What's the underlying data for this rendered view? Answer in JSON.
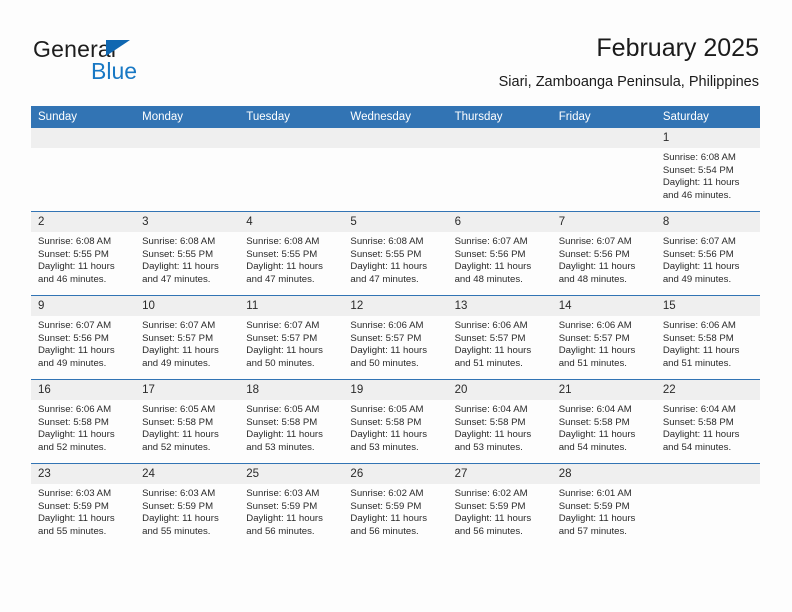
{
  "brand": {
    "word_one": "General",
    "word_two": "Blue",
    "icon": "triangle-logo-icon"
  },
  "header": {
    "month_title": "February 2025",
    "location": "Siari, Zamboanga Peninsula, Philippines"
  },
  "colors": {
    "header_blue": "#3274b4",
    "brand_blue": "#1878c4",
    "daynum_band": "#efefef",
    "page_background": "#fdfdfd",
    "text": "#2a2a2a"
  },
  "calendar": {
    "weekday_headers": [
      "Sunday",
      "Monday",
      "Tuesday",
      "Wednesday",
      "Thursday",
      "Friday",
      "Saturday"
    ],
    "labels": {
      "sunrise": "Sunrise:",
      "sunset": "Sunset:",
      "daylight": "Daylight:"
    },
    "weeks": [
      [
        {
          "day": "",
          "blank": true,
          "sunrise": "",
          "sunset": "",
          "daylight_line1": "",
          "daylight_line2": ""
        },
        {
          "day": "",
          "blank": true,
          "sunrise": "",
          "sunset": "",
          "daylight_line1": "",
          "daylight_line2": ""
        },
        {
          "day": "",
          "blank": true,
          "sunrise": "",
          "sunset": "",
          "daylight_line1": "",
          "daylight_line2": ""
        },
        {
          "day": "",
          "blank": true,
          "sunrise": "",
          "sunset": "",
          "daylight_line1": "",
          "daylight_line2": ""
        },
        {
          "day": "",
          "blank": true,
          "sunrise": "",
          "sunset": "",
          "daylight_line1": "",
          "daylight_line2": ""
        },
        {
          "day": "",
          "blank": true,
          "sunrise": "",
          "sunset": "",
          "daylight_line1": "",
          "daylight_line2": ""
        },
        {
          "day": "1",
          "blank": false,
          "sunrise": "Sunrise: 6:08 AM",
          "sunset": "Sunset: 5:54 PM",
          "daylight_line1": "Daylight: 11 hours",
          "daylight_line2": "and 46 minutes."
        }
      ],
      [
        {
          "day": "2",
          "blank": false,
          "sunrise": "Sunrise: 6:08 AM",
          "sunset": "Sunset: 5:55 PM",
          "daylight_line1": "Daylight: 11 hours",
          "daylight_line2": "and 46 minutes."
        },
        {
          "day": "3",
          "blank": false,
          "sunrise": "Sunrise: 6:08 AM",
          "sunset": "Sunset: 5:55 PM",
          "daylight_line1": "Daylight: 11 hours",
          "daylight_line2": "and 47 minutes."
        },
        {
          "day": "4",
          "blank": false,
          "sunrise": "Sunrise: 6:08 AM",
          "sunset": "Sunset: 5:55 PM",
          "daylight_line1": "Daylight: 11 hours",
          "daylight_line2": "and 47 minutes."
        },
        {
          "day": "5",
          "blank": false,
          "sunrise": "Sunrise: 6:08 AM",
          "sunset": "Sunset: 5:55 PM",
          "daylight_line1": "Daylight: 11 hours",
          "daylight_line2": "and 47 minutes."
        },
        {
          "day": "6",
          "blank": false,
          "sunrise": "Sunrise: 6:07 AM",
          "sunset": "Sunset: 5:56 PM",
          "daylight_line1": "Daylight: 11 hours",
          "daylight_line2": "and 48 minutes."
        },
        {
          "day": "7",
          "blank": false,
          "sunrise": "Sunrise: 6:07 AM",
          "sunset": "Sunset: 5:56 PM",
          "daylight_line1": "Daylight: 11 hours",
          "daylight_line2": "and 48 minutes."
        },
        {
          "day": "8",
          "blank": false,
          "sunrise": "Sunrise: 6:07 AM",
          "sunset": "Sunset: 5:56 PM",
          "daylight_line1": "Daylight: 11 hours",
          "daylight_line2": "and 49 minutes."
        }
      ],
      [
        {
          "day": "9",
          "blank": false,
          "sunrise": "Sunrise: 6:07 AM",
          "sunset": "Sunset: 5:56 PM",
          "daylight_line1": "Daylight: 11 hours",
          "daylight_line2": "and 49 minutes."
        },
        {
          "day": "10",
          "blank": false,
          "sunrise": "Sunrise: 6:07 AM",
          "sunset": "Sunset: 5:57 PM",
          "daylight_line1": "Daylight: 11 hours",
          "daylight_line2": "and 49 minutes."
        },
        {
          "day": "11",
          "blank": false,
          "sunrise": "Sunrise: 6:07 AM",
          "sunset": "Sunset: 5:57 PM",
          "daylight_line1": "Daylight: 11 hours",
          "daylight_line2": "and 50 minutes."
        },
        {
          "day": "12",
          "blank": false,
          "sunrise": "Sunrise: 6:06 AM",
          "sunset": "Sunset: 5:57 PM",
          "daylight_line1": "Daylight: 11 hours",
          "daylight_line2": "and 50 minutes."
        },
        {
          "day": "13",
          "blank": false,
          "sunrise": "Sunrise: 6:06 AM",
          "sunset": "Sunset: 5:57 PM",
          "daylight_line1": "Daylight: 11 hours",
          "daylight_line2": "and 51 minutes."
        },
        {
          "day": "14",
          "blank": false,
          "sunrise": "Sunrise: 6:06 AM",
          "sunset": "Sunset: 5:57 PM",
          "daylight_line1": "Daylight: 11 hours",
          "daylight_line2": "and 51 minutes."
        },
        {
          "day": "15",
          "blank": false,
          "sunrise": "Sunrise: 6:06 AM",
          "sunset": "Sunset: 5:58 PM",
          "daylight_line1": "Daylight: 11 hours",
          "daylight_line2": "and 51 minutes."
        }
      ],
      [
        {
          "day": "16",
          "blank": false,
          "sunrise": "Sunrise: 6:06 AM",
          "sunset": "Sunset: 5:58 PM",
          "daylight_line1": "Daylight: 11 hours",
          "daylight_line2": "and 52 minutes."
        },
        {
          "day": "17",
          "blank": false,
          "sunrise": "Sunrise: 6:05 AM",
          "sunset": "Sunset: 5:58 PM",
          "daylight_line1": "Daylight: 11 hours",
          "daylight_line2": "and 52 minutes."
        },
        {
          "day": "18",
          "blank": false,
          "sunrise": "Sunrise: 6:05 AM",
          "sunset": "Sunset: 5:58 PM",
          "daylight_line1": "Daylight: 11 hours",
          "daylight_line2": "and 53 minutes."
        },
        {
          "day": "19",
          "blank": false,
          "sunrise": "Sunrise: 6:05 AM",
          "sunset": "Sunset: 5:58 PM",
          "daylight_line1": "Daylight: 11 hours",
          "daylight_line2": "and 53 minutes."
        },
        {
          "day": "20",
          "blank": false,
          "sunrise": "Sunrise: 6:04 AM",
          "sunset": "Sunset: 5:58 PM",
          "daylight_line1": "Daylight: 11 hours",
          "daylight_line2": "and 53 minutes."
        },
        {
          "day": "21",
          "blank": false,
          "sunrise": "Sunrise: 6:04 AM",
          "sunset": "Sunset: 5:58 PM",
          "daylight_line1": "Daylight: 11 hours",
          "daylight_line2": "and 54 minutes."
        },
        {
          "day": "22",
          "blank": false,
          "sunrise": "Sunrise: 6:04 AM",
          "sunset": "Sunset: 5:58 PM",
          "daylight_line1": "Daylight: 11 hours",
          "daylight_line2": "and 54 minutes."
        }
      ],
      [
        {
          "day": "23",
          "blank": false,
          "sunrise": "Sunrise: 6:03 AM",
          "sunset": "Sunset: 5:59 PM",
          "daylight_line1": "Daylight: 11 hours",
          "daylight_line2": "and 55 minutes."
        },
        {
          "day": "24",
          "blank": false,
          "sunrise": "Sunrise: 6:03 AM",
          "sunset": "Sunset: 5:59 PM",
          "daylight_line1": "Daylight: 11 hours",
          "daylight_line2": "and 55 minutes."
        },
        {
          "day": "25",
          "blank": false,
          "sunrise": "Sunrise: 6:03 AM",
          "sunset": "Sunset: 5:59 PM",
          "daylight_line1": "Daylight: 11 hours",
          "daylight_line2": "and 56 minutes."
        },
        {
          "day": "26",
          "blank": false,
          "sunrise": "Sunrise: 6:02 AM",
          "sunset": "Sunset: 5:59 PM",
          "daylight_line1": "Daylight: 11 hours",
          "daylight_line2": "and 56 minutes."
        },
        {
          "day": "27",
          "blank": false,
          "sunrise": "Sunrise: 6:02 AM",
          "sunset": "Sunset: 5:59 PM",
          "daylight_line1": "Daylight: 11 hours",
          "daylight_line2": "and 56 minutes."
        },
        {
          "day": "28",
          "blank": false,
          "sunrise": "Sunrise: 6:01 AM",
          "sunset": "Sunset: 5:59 PM",
          "daylight_line1": "Daylight: 11 hours",
          "daylight_line2": "and 57 minutes."
        },
        {
          "day": "",
          "blank": true,
          "sunrise": "",
          "sunset": "",
          "daylight_line1": "",
          "daylight_line2": ""
        }
      ]
    ]
  }
}
